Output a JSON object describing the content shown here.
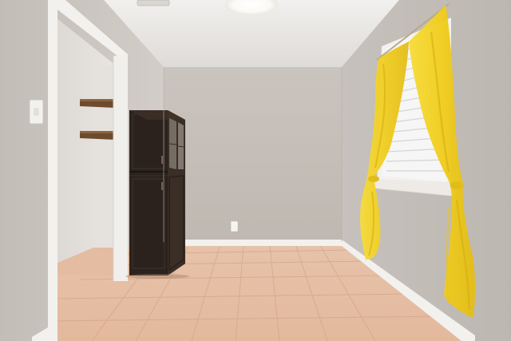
{
  "scene": {
    "subject": "empty-room-interior",
    "elements": [
      "ceiling-light",
      "smoke-detector",
      "closet-doorway",
      "closet-wood-shelf",
      "light-switch-plate",
      "dark-wood-cabinet",
      "glass-cabinet-doors",
      "wall-outlet",
      "baseboard-trim",
      "window-with-blinds",
      "yellow-sheer-curtains",
      "tile-floor"
    ]
  },
  "colors": {
    "wall_back": "#c4bdb6",
    "wall_left": "#cbc6c1",
    "wall_right": "#c9c4c0",
    "ceiling": "#e8e6e4",
    "floor_tile": "#e2b79c",
    "grout": "#cf9f85",
    "cabinet": "#2a211c",
    "cabinet_edge": "#3b2f27",
    "curtain": "#f2d227",
    "curtain_shade": "#d7b316",
    "blinds": "#f4f4f4",
    "trim": "#f3f1ee",
    "shelf": "#6b4a2c"
  }
}
